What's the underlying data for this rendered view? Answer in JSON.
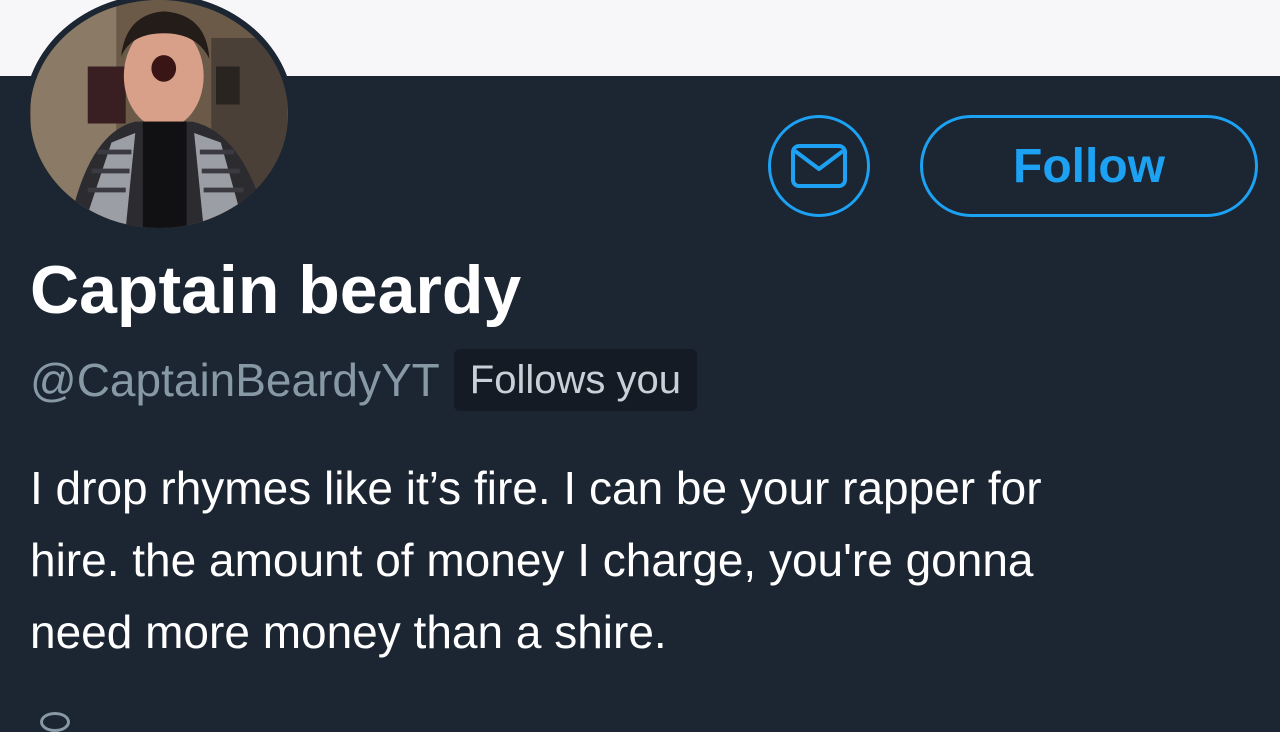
{
  "profile": {
    "display_name": "Captain beardy",
    "handle": "@CaptainBeardyYT",
    "follows_you": "Follows you",
    "bio_lines": [
      "I drop rhymes like it’s fire. I can be your rapper for",
      "hire. the amount of money I charge, you're gonna",
      "need more money than a shire."
    ]
  },
  "actions": {
    "follow_label": "Follow",
    "message_icon": "envelope-icon"
  },
  "colors": {
    "background": "#1c2532",
    "accent": "#1da1f2",
    "secondary_text": "#8899a6",
    "banner": "#f7f7f9"
  }
}
